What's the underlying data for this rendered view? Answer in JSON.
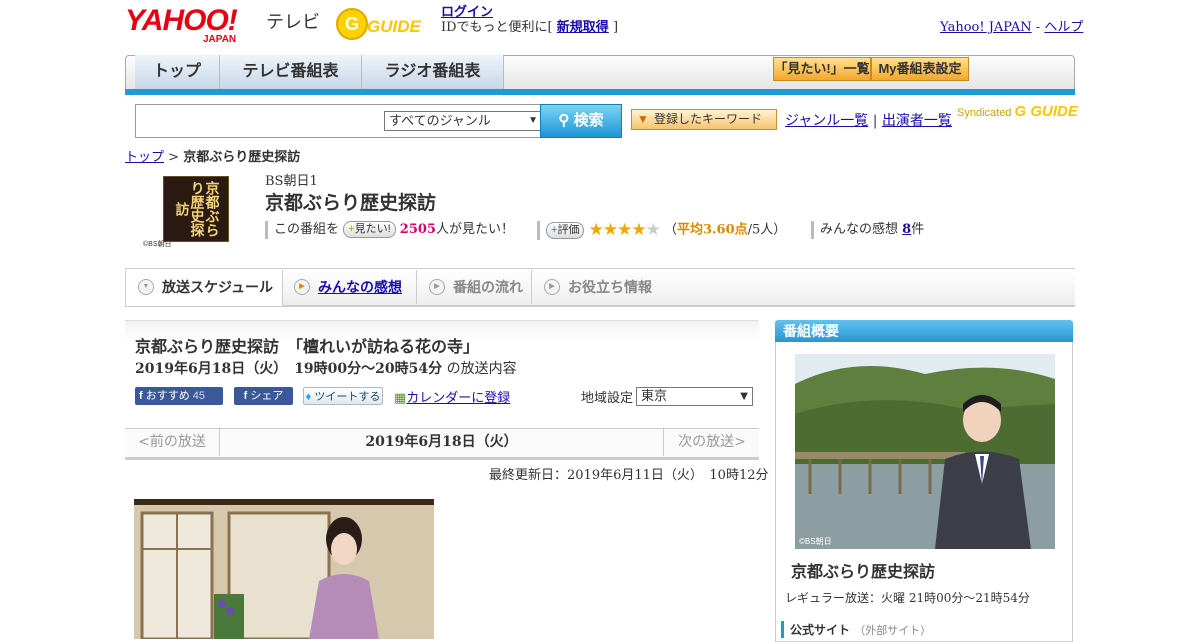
{
  "header": {
    "logo_main": "YAHOO!",
    "logo_sub": "JAPAN",
    "tv_label": "テレビ",
    "gguide_logo": "G GUIDE",
    "login_link": "ログイン",
    "login_prompt": "IDでもっと便利に[",
    "register_link": "新規取得",
    "register_close": "]",
    "yahoo_japan_link": "Yahoo! JAPAN",
    "separator": "-",
    "help_link": "ヘルプ"
  },
  "nav": {
    "tabs": [
      {
        "label": "トップ"
      },
      {
        "label": "テレビ番組表"
      },
      {
        "label": "ラジオ番組表"
      }
    ],
    "mitai_list": "「見たい!」一覧",
    "my_settings": "My番組表設定"
  },
  "search": {
    "input_value": "",
    "genre_selected": "すべてのジャンル",
    "button_label": "検索",
    "keyword_button": "登録したキーワード",
    "genre_list_link": "ジャンル一覧",
    "divider": "|",
    "performer_link": "出演者一覧",
    "syndicated": "Syndicated"
  },
  "breadcrumb": {
    "top": "トップ",
    "sep": ">",
    "current": "京都ぶらり歴史探訪"
  },
  "program": {
    "thumb_text": "京都ぶらり歴史探訪",
    "thumb_credit": "©BS朝日",
    "channel": "BS朝日1",
    "title": "京都ぶらり歴史探訪",
    "watch_prefix": "この番組を",
    "watch_button": "見たい!",
    "watch_count": "2505",
    "watch_suffix": "人が見たい！",
    "rate_button": "評価",
    "rating_value": 3.6,
    "rating_open": "（",
    "rating_avg": "平均3.60点",
    "rating_count": "/5人）",
    "reviews_label": "みんなの感想",
    "reviews_count": "8",
    "reviews_unit": "件"
  },
  "program_tabs": [
    {
      "label": "放送スケジュール"
    },
    {
      "label": "みんなの感想"
    },
    {
      "label": "番組の流れ"
    },
    {
      "label": "お役立ち情報"
    }
  ],
  "episode": {
    "title": "京都ぶらり歴史探訪　「檀れいが訪ねる花の寺」",
    "date_time": "2019年6月18日（火）　19時00分～20時54分",
    "date_suffix": "の放送内容",
    "recommend_label": "おすすめ",
    "recommend_count": "45",
    "share_label": "シェア",
    "tweet_label": "ツイートする",
    "calendar_label": "カレンダーに登録",
    "region_label": "地域設定",
    "region_value": "東京",
    "prev_link": "<前の放送",
    "current_date": "2019年6月18日（火）",
    "next_link": "次の放送>",
    "updated": "最終更新日：2019年6月11日（火）　10時12分"
  },
  "sidebar": {
    "heading": "番組概要",
    "image_credit": "©BS朝日",
    "title": "京都ぶらり歴史探訪",
    "regular": "レギュラー放送：火曜 21時00分～21時54分",
    "official_site": "公式サイト",
    "external_note": "（外部サイト）"
  },
  "colors": {
    "brand_red": "#e60012",
    "blue_bar": "#1e9ad6",
    "star": "#f0a800",
    "link": "#1a0dab"
  }
}
